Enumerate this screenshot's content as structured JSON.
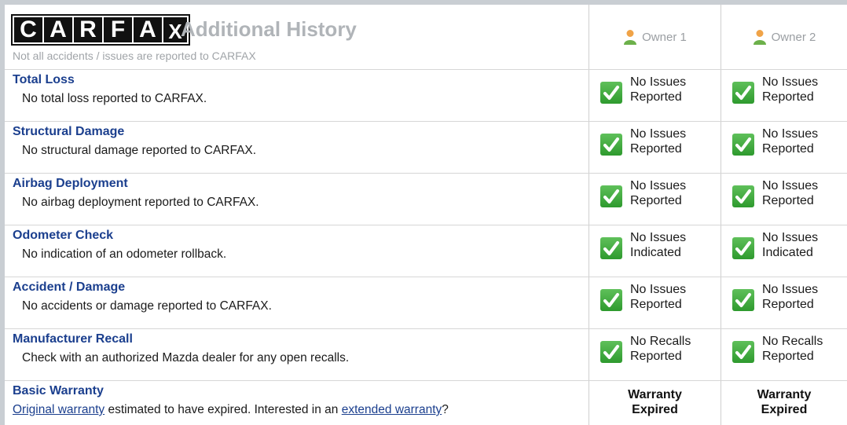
{
  "header": {
    "logo_letters": [
      "C",
      "A",
      "R",
      "F",
      "A",
      "X"
    ],
    "title": "Additional History",
    "subtitle": "Not all accidents / issues are reported to CARFAX",
    "owners": [
      "Owner 1",
      "Owner 2"
    ]
  },
  "rows": [
    {
      "title": "Total Loss",
      "description": "No total loss reported to CARFAX.",
      "owner1": {
        "icon": "checkmark-icon",
        "line1": "No Issues",
        "line2": "Reported"
      },
      "owner2": {
        "icon": "checkmark-icon",
        "line1": "No Issues",
        "line2": "Reported"
      }
    },
    {
      "title": "Structural Damage",
      "description": "No structural damage reported to CARFAX.",
      "owner1": {
        "icon": "checkmark-icon",
        "line1": "No Issues",
        "line2": "Reported"
      },
      "owner2": {
        "icon": "checkmark-icon",
        "line1": "No Issues",
        "line2": "Reported"
      }
    },
    {
      "title": "Airbag Deployment",
      "description": "No airbag deployment reported to CARFAX.",
      "owner1": {
        "icon": "checkmark-icon",
        "line1": "No Issues",
        "line2": "Reported"
      },
      "owner2": {
        "icon": "checkmark-icon",
        "line1": "No Issues",
        "line2": "Reported"
      }
    },
    {
      "title": "Odometer Check",
      "description": "No indication of an odometer rollback.",
      "owner1": {
        "icon": "checkmark-icon",
        "line1": "No Issues",
        "line2": "Indicated"
      },
      "owner2": {
        "icon": "checkmark-icon",
        "line1": "No Issues",
        "line2": "Indicated"
      }
    },
    {
      "title": "Accident / Damage",
      "description": "No accidents or damage reported to CARFAX.",
      "owner1": {
        "icon": "checkmark-icon",
        "line1": "No Issues",
        "line2": "Reported"
      },
      "owner2": {
        "icon": "checkmark-icon",
        "line1": "No Issues",
        "line2": "Reported"
      }
    },
    {
      "title": "Manufacturer Recall",
      "description": "Check with an authorized Mazda dealer for any open recalls.",
      "owner1": {
        "icon": "checkmark-icon",
        "line1": "No Recalls",
        "line2": "Reported"
      },
      "owner2": {
        "icon": "checkmark-icon",
        "line1": "No Recalls",
        "line2": "Reported"
      }
    }
  ],
  "warranty": {
    "title": "Basic Warranty",
    "link1": "Original warranty",
    "text_mid": " estimated to have expired. Interested in an ",
    "link2": "extended warranty",
    "text_end": "?",
    "owner1": {
      "line1": "Warranty",
      "line2": "Expired"
    },
    "owner2": {
      "line1": "Warranty",
      "line2": "Expired"
    }
  },
  "colors": {
    "title_blue": "#1b3f8e",
    "check_green": "#3aa83a",
    "header_gray": "#b0b4b8"
  }
}
